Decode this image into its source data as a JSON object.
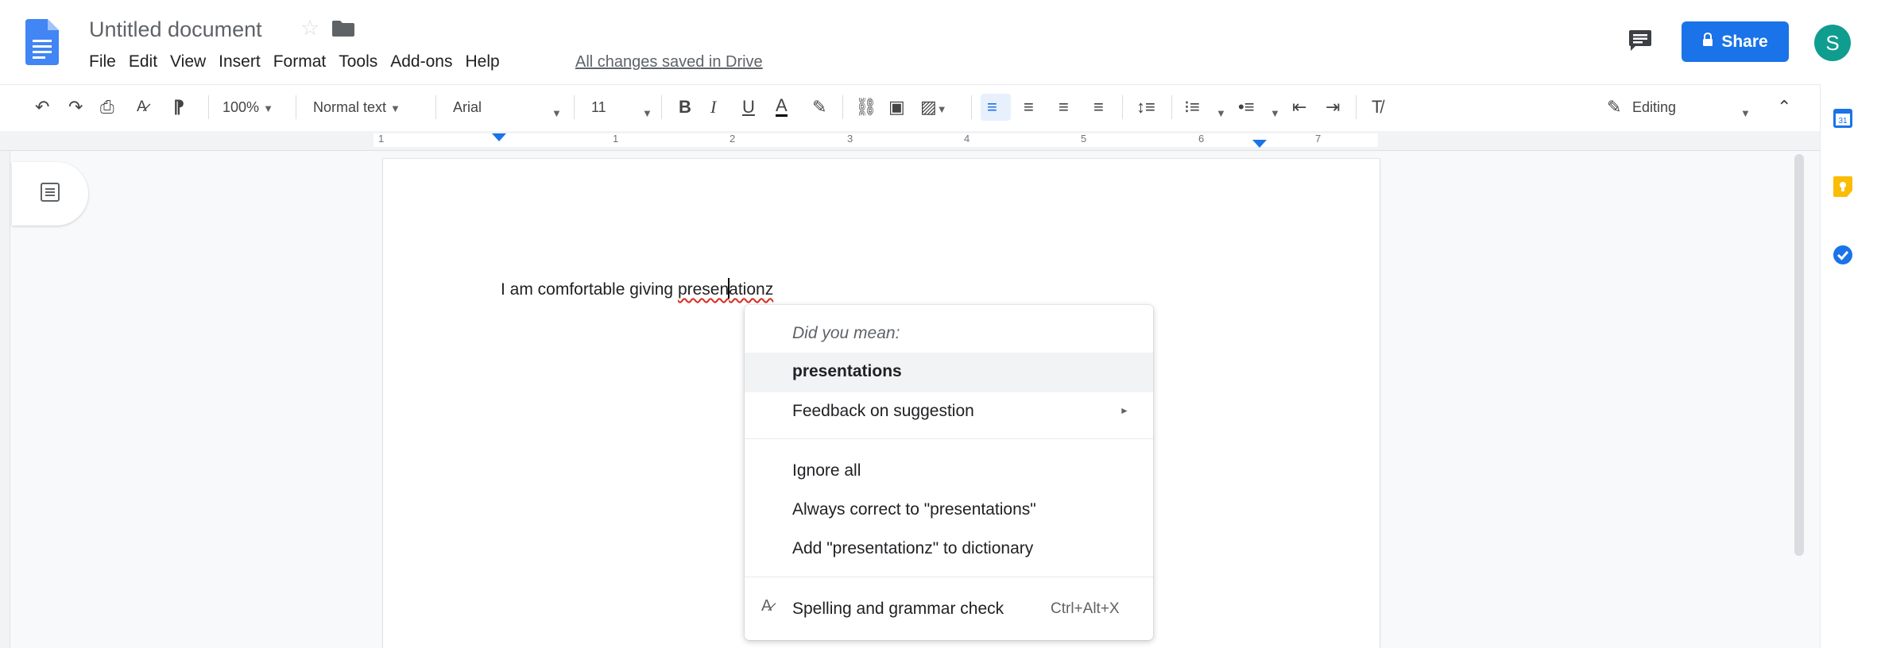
{
  "header": {
    "title": "Untitled document",
    "menu": [
      "File",
      "Edit",
      "View",
      "Insert",
      "Format",
      "Tools",
      "Add-ons",
      "Help"
    ],
    "save_status": "All changes saved in Drive",
    "share_label": "Share",
    "avatar_initial": "S"
  },
  "toolbar": {
    "zoom": "100%",
    "style": "Normal text",
    "font": "Arial",
    "font_size": "11",
    "bold": "B",
    "italic": "I",
    "underline": "U",
    "text_color": "A",
    "mode": "Editing"
  },
  "ruler": {
    "numbers": [
      "1",
      "1",
      "2",
      "3",
      "4",
      "5",
      "6",
      "7"
    ]
  },
  "document": {
    "text_before": "I am comfortable giving ",
    "misspelled_start": "presen",
    "misspelled_end": "ationz"
  },
  "context_menu": {
    "heading": "Did you mean:",
    "suggestion": "presentations",
    "feedback": "Feedback on suggestion",
    "ignore_all": "Ignore all",
    "always_correct": "Always correct to \"presentations\"",
    "add_to_dictionary": "Add \"presentationz\" to dictionary",
    "spell_check": "Spelling and grammar check",
    "spell_check_shortcut": "Ctrl+Alt+X"
  },
  "colors": {
    "accent": "#1a73e8",
    "avatar": "#0f9d8f",
    "misspell_underline": "#d93025"
  },
  "icons": {
    "side_panel": [
      "calendar-icon",
      "keep-icon",
      "tasks-icon"
    ]
  }
}
